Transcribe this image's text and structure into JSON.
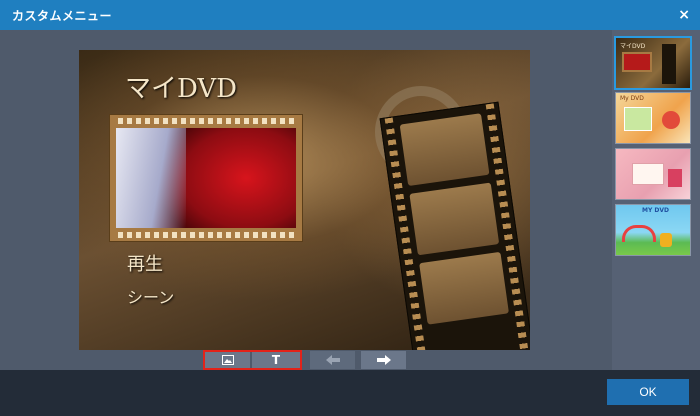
{
  "window": {
    "title": "カスタムメニュー",
    "close_glyph": "×"
  },
  "preview": {
    "menu_title": "マイDVD",
    "menu_items": [
      "再生",
      "シーン"
    ]
  },
  "toolbar": {
    "image_button_icon": "image-icon",
    "text_button_label": "T",
    "prev_arrow_icon": "arrow-left-icon",
    "next_arrow_icon": "arrow-right-icon"
  },
  "templates": {
    "selected_index": 0,
    "thumb_1": {
      "title": "マイDVD"
    },
    "thumb_2": {
      "title": "My DVD"
    },
    "thumb_4": {
      "title": "MY DVD"
    }
  },
  "footer": {
    "ok_label": "OK"
  },
  "colors": {
    "titlebar": "#1f7fc0",
    "highlight": "#e2231a",
    "ok_button": "#1f6fb0"
  }
}
